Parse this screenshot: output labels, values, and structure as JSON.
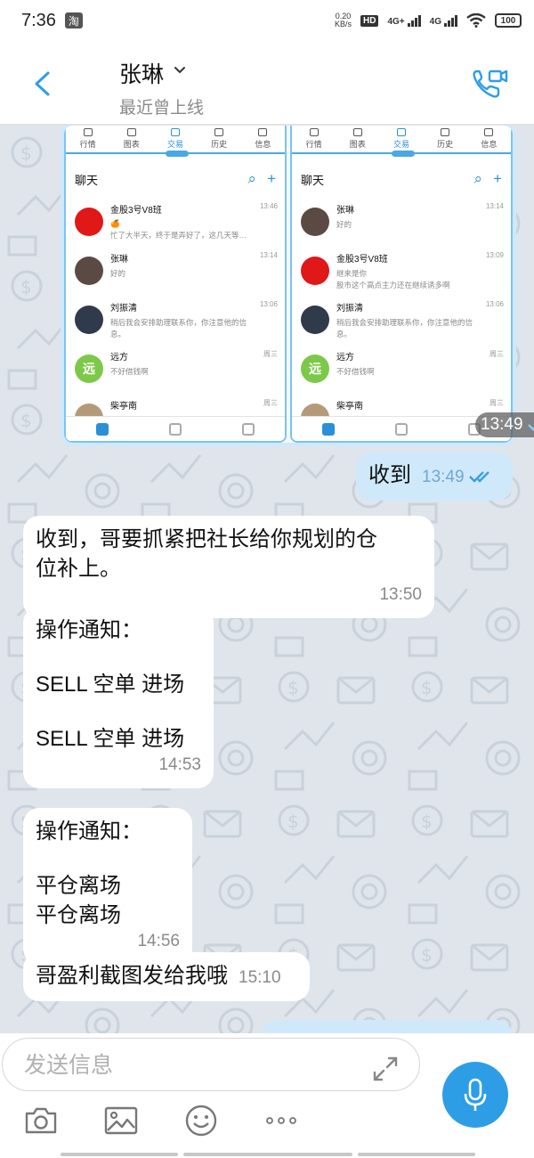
{
  "status_bar": {
    "time": "7:36",
    "app_badge": "淘",
    "speed_value": "0.20",
    "speed_unit": "KB/s",
    "hd": "HD",
    "network_1": "4G+",
    "network_2": "4G",
    "battery": "100"
  },
  "header": {
    "contact_name": "张琳",
    "contact_status": "最近曾上线"
  },
  "screenshot": {
    "tabs": [
      "行情",
      "图表",
      "交易",
      "历史",
      "信息"
    ],
    "active_tab": "交易",
    "header_title": "聊天",
    "left_list": [
      {
        "name": "金股3号V8班",
        "time": "13:46",
        "msg": "🍊",
        "msg2": "忙了大半天，终于是弄好了，这几天等…",
        "avatar_color": "#e01818",
        "avatar_text": "",
        "group": true
      },
      {
        "name": "张琳",
        "time": "13:14",
        "msg": "好的",
        "msg2": "",
        "avatar_color": "#5b4a44",
        "avatar_text": "",
        "read": true
      },
      {
        "name": "刘振清",
        "time": "13:06",
        "msg": "稍后我会安排助理联系你，你注意他的信",
        "msg2": "息。",
        "avatar_color": "#2f3a4a",
        "avatar_text": ""
      },
      {
        "name": "远方",
        "time": "周三",
        "msg": "不好借钱啊",
        "msg2": "",
        "avatar_color": "#7cc94a",
        "avatar_text": "远"
      },
      {
        "name": "柴亭南",
        "time": "周三",
        "msg": "",
        "msg2": "",
        "avatar_color": "#b59a7a",
        "avatar_text": ""
      }
    ],
    "right_list": [
      {
        "name": "张琳",
        "time": "13:14",
        "msg": "好的",
        "msg2": "",
        "avatar_color": "#5b4a44",
        "avatar_text": "",
        "read": true
      },
      {
        "name": "金股3号V8班",
        "time": "13:09",
        "msg": "继来是你",
        "msg2": "股市这个高点主力还在继续诱多啊",
        "avatar_color": "#e01818",
        "avatar_text": "",
        "group": true
      },
      {
        "name": "刘振清",
        "time": "13:06",
        "msg": "稍后我会安排助理联系你，你注意他的信",
        "msg2": "息。",
        "avatar_color": "#2f3a4a",
        "avatar_text": ""
      },
      {
        "name": "远方",
        "time": "周三",
        "msg": "不好借钱啊",
        "msg2": "",
        "avatar_color": "#7cc94a",
        "avatar_text": "远"
      },
      {
        "name": "柴亭南",
        "time": "周三",
        "msg": "",
        "msg2": "",
        "avatar_color": "#b59a7a",
        "avatar_text": ""
      }
    ],
    "time": "13:49"
  },
  "messages": [
    {
      "direction": "out",
      "lines": [
        "收到"
      ],
      "time": "13:49"
    },
    {
      "direction": "in",
      "lines": [
        "收到，哥要抓紧把社长给你规划的仓",
        "位补上。"
      ],
      "time": "13:50"
    },
    {
      "direction": "in",
      "lines": [
        "操作通知：",
        "",
        "SELL 空单 进场",
        "",
        "SELL 空单 进场"
      ],
      "time": "14:53"
    },
    {
      "direction": "in",
      "lines": [
        "操作通知：",
        "",
        "平仓离场",
        "平仓离场"
      ],
      "time": "14:56"
    },
    {
      "direction": "in",
      "lines": [
        "哥盈利截图发给我哦"
      ],
      "time": "15:10"
    }
  ],
  "composer": {
    "placeholder": "发送信息"
  },
  "colors": {
    "accent": "#2d9ee6",
    "outgoing_bubble": "#cfe9fb",
    "incoming_bubble": "#ffffff",
    "chat_background": "#dfe5eb"
  },
  "icons": [
    "back-arrow-icon",
    "chevron-down-icon",
    "phone-video-icon",
    "double-check-icon",
    "chevron-down-scroll-icon",
    "expand-icon",
    "microphone-icon",
    "camera-icon",
    "image-icon",
    "emoji-icon",
    "more-dots-icon"
  ]
}
